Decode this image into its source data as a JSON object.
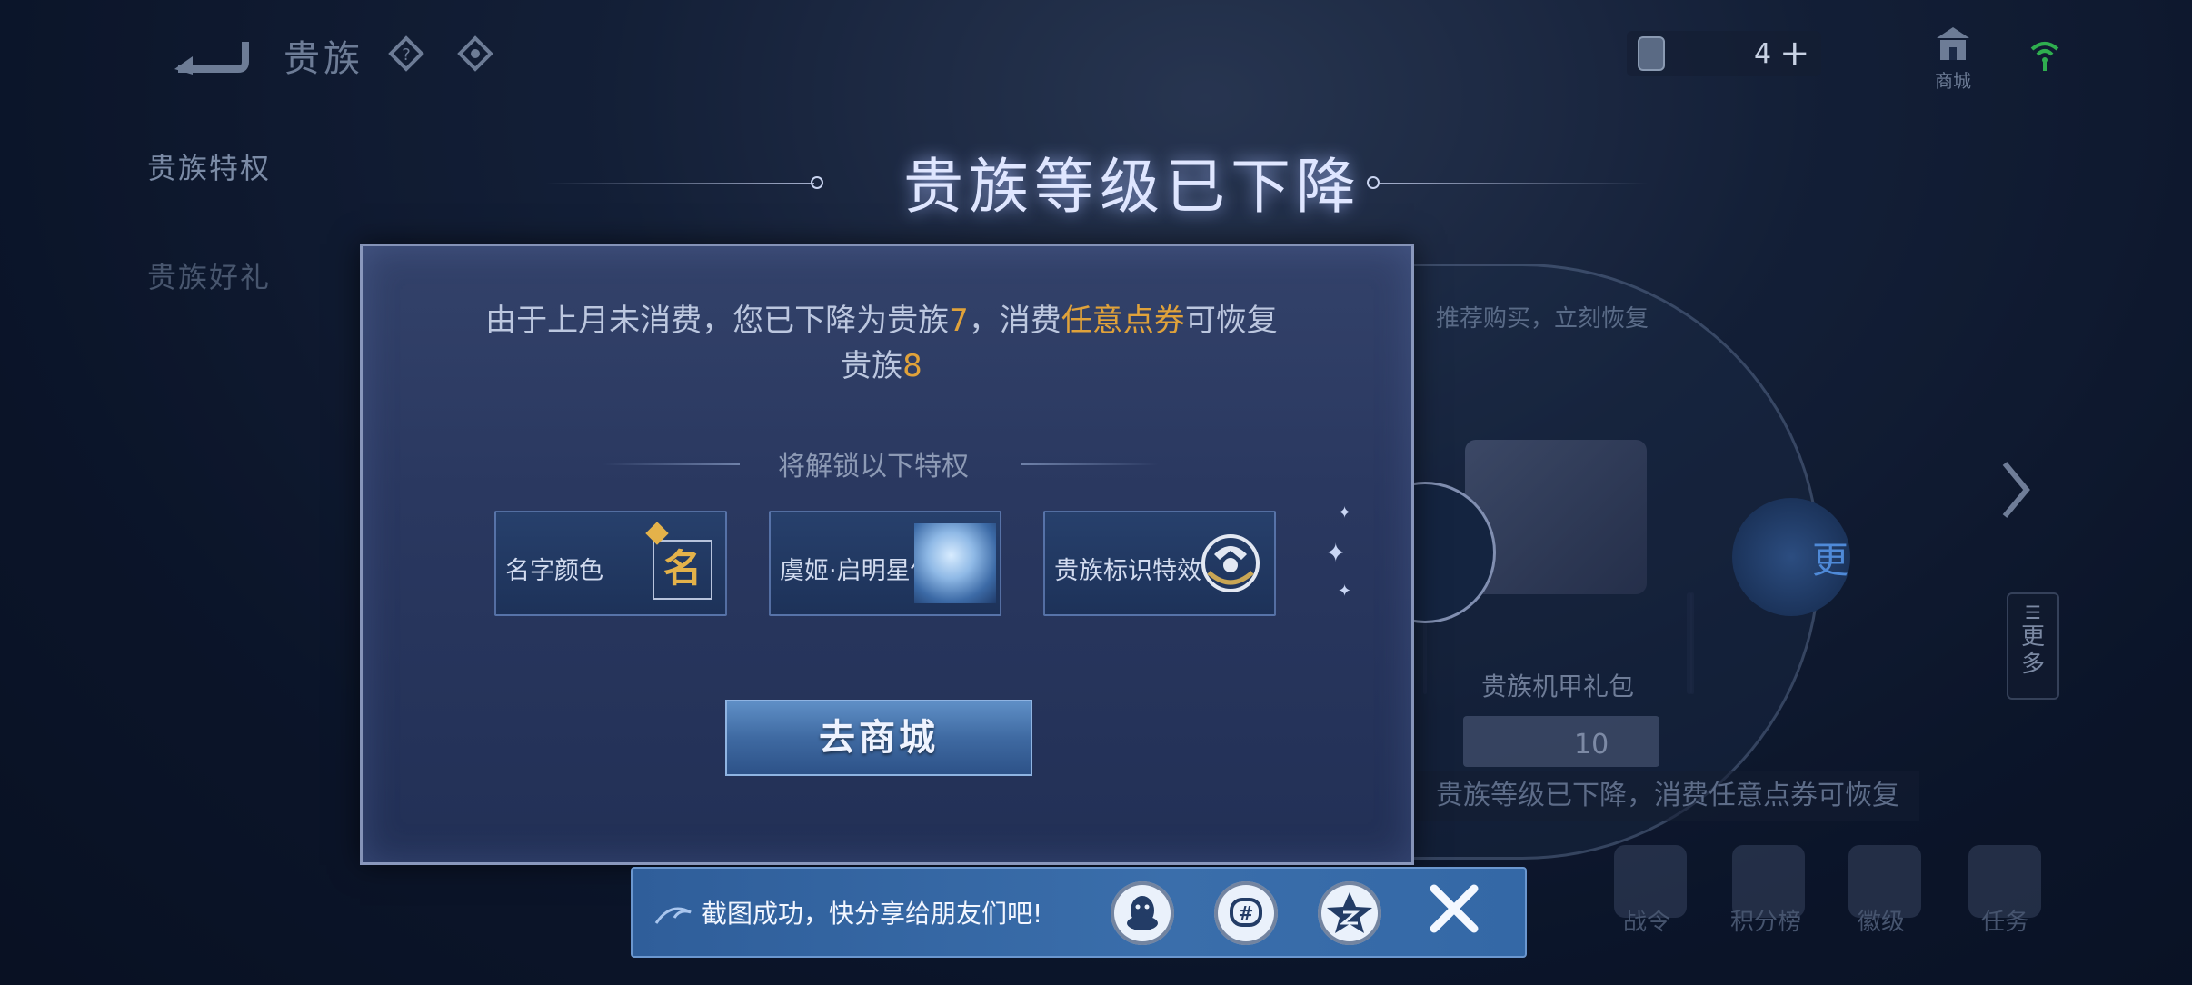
{
  "header": {
    "title": "贵族",
    "icons": [
      "back-arrow-icon",
      "diamond-help-icon",
      "diamond-settings-icon"
    ],
    "currency_count": "4",
    "currency_plus": "+",
    "shop_label": "商城"
  },
  "sidebar": {
    "items": [
      {
        "label": "贵族特权",
        "active": true
      },
      {
        "label": "贵族好礼",
        "active": false
      }
    ]
  },
  "background": {
    "banner": "推荐购买，立刻恢复",
    "pack_label": "贵族机甲礼包",
    "price": "10",
    "notice": "贵族等级已下降，消费任意点券可恢复",
    "more_label": "更",
    "list_label": "更多",
    "bottom_nav": [
      "战令",
      "积分榜",
      "徽级",
      "任务"
    ]
  },
  "dialog": {
    "title": "贵族等级已下降",
    "message_part1": "由于上月未消费，您已下降为贵族",
    "message_level_current": "7",
    "message_part2": "，消费",
    "message_highlight": "任意点券",
    "message_part3": "可恢复",
    "message_part4": "贵族",
    "message_level_target": "8",
    "unlock_heading": "将解锁以下特权",
    "privileges": [
      {
        "label": "名字颜色",
        "badge": "名",
        "icon": "name-color-icon"
      },
      {
        "label": "虞姬·启明星使",
        "icon": "hero-skin-portrait"
      },
      {
        "label": "贵族标识特效",
        "icon": "noble-emblem-icon"
      }
    ],
    "shop_button": "去商城"
  },
  "share_bar": {
    "text": "截图成功，快分享给朋友们吧!",
    "icons": [
      "qq-icon",
      "wechat-moments-icon",
      "qzone-icon",
      "close-icon"
    ]
  },
  "colors": {
    "highlight": "#e0a23a",
    "dialog_bg": "#2a3860",
    "share_bar_bg": "#3a6eab"
  }
}
